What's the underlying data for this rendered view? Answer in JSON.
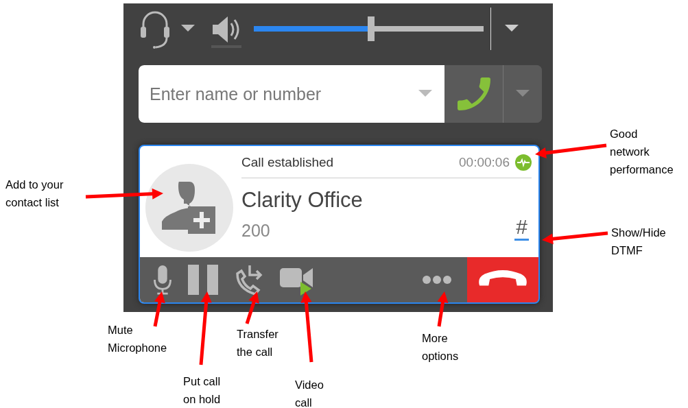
{
  "toolbar": {
    "volume": {
      "level": 0.5
    }
  },
  "dial": {
    "placeholder": "Enter name or number"
  },
  "call": {
    "status": "Call established",
    "duration": "00:00:06",
    "network_good": true,
    "name": "Clarity Office",
    "number": "200",
    "dtmf": {
      "label": "#",
      "selected": true
    }
  },
  "annotations": [
    {
      "lines": [
        "Add to your",
        "contact list"
      ]
    },
    {
      "lines": [
        "Good",
        "network",
        "performance"
      ]
    },
    {
      "lines": [
        "Show/Hide",
        "DTMF"
      ]
    },
    {
      "lines": [
        "Mute",
        "Microphone"
      ]
    },
    {
      "lines": [
        "Put call",
        "on hold"
      ]
    },
    {
      "lines": [
        "Transfer",
        "the call"
      ]
    },
    {
      "lines": [
        "Video",
        "call"
      ]
    },
    {
      "lines": [
        "More",
        "options"
      ]
    }
  ]
}
